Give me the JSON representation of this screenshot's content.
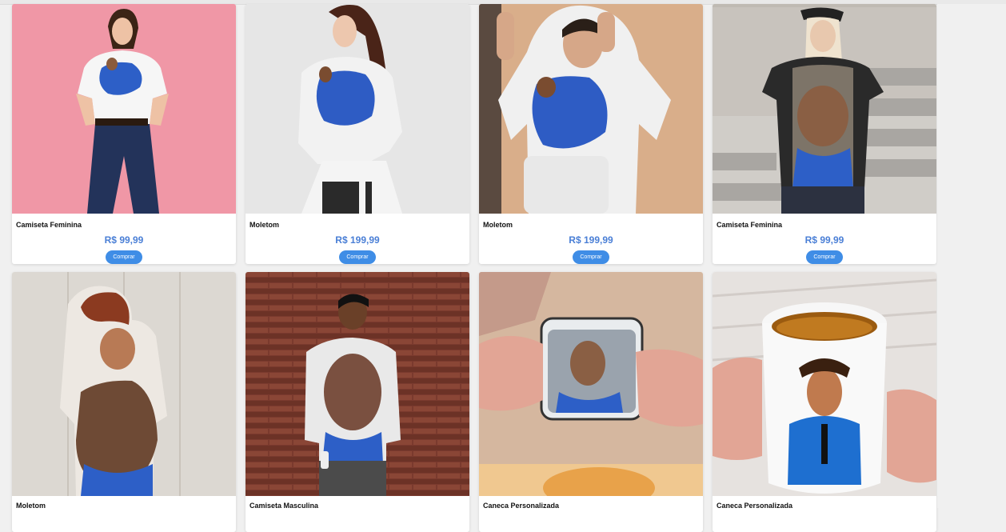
{
  "products": [
    {
      "name": "Camiseta Feminina",
      "price": "R$ 99,99",
      "buy_label": "Comprar",
      "scene": "woman-tshirt-pink"
    },
    {
      "name": "Moletom",
      "price": "R$ 199,99",
      "buy_label": "Comprar",
      "scene": "woman-sweatshirt-grey"
    },
    {
      "name": "Moletom",
      "price": "R$ 199,99",
      "buy_label": "Comprar",
      "scene": "man-hoodie-beige"
    },
    {
      "name": "Camiseta Feminina",
      "price": "R$ 99,99",
      "buy_label": "Comprar",
      "scene": "woman-tshirt-stairs"
    },
    {
      "name": "Moletom",
      "scene": "woman-sweatshirt-wall"
    },
    {
      "name": "Camiseta Masculina",
      "scene": "man-tshirt-brick"
    },
    {
      "name": "Caneca Personalizada",
      "scene": "enamel-mug"
    },
    {
      "name": "Caneca Personalizada",
      "scene": "white-mug-tea"
    }
  ],
  "colors": {
    "price": "#4a7fd6",
    "button": "#3f8de6"
  }
}
